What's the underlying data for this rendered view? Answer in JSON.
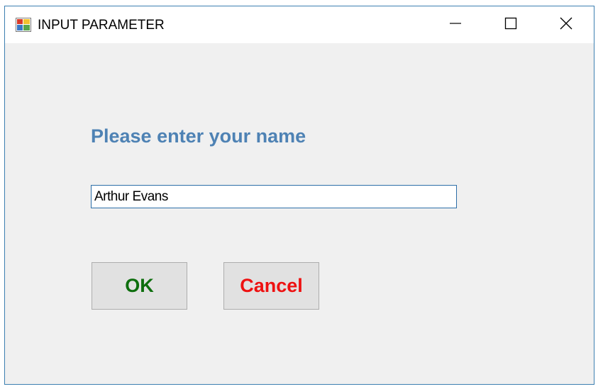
{
  "window": {
    "title": "INPUT PARAMETER",
    "icon": "application-icon",
    "controls": {
      "minimize_icon": "minimize-icon",
      "maximize_icon": "maximize-icon",
      "close_icon": "close-icon"
    }
  },
  "form": {
    "prompt": "Please enter your name",
    "name_value": "Arthur Evans",
    "ok_label": "OK",
    "cancel_label": "Cancel"
  },
  "colors": {
    "prompt": "#4e82b4",
    "ok_text": "#0d6e0d",
    "cancel_text": "#ee1111",
    "window_border": "#3c7fb1",
    "dialog_background": "#f0f0f0"
  }
}
